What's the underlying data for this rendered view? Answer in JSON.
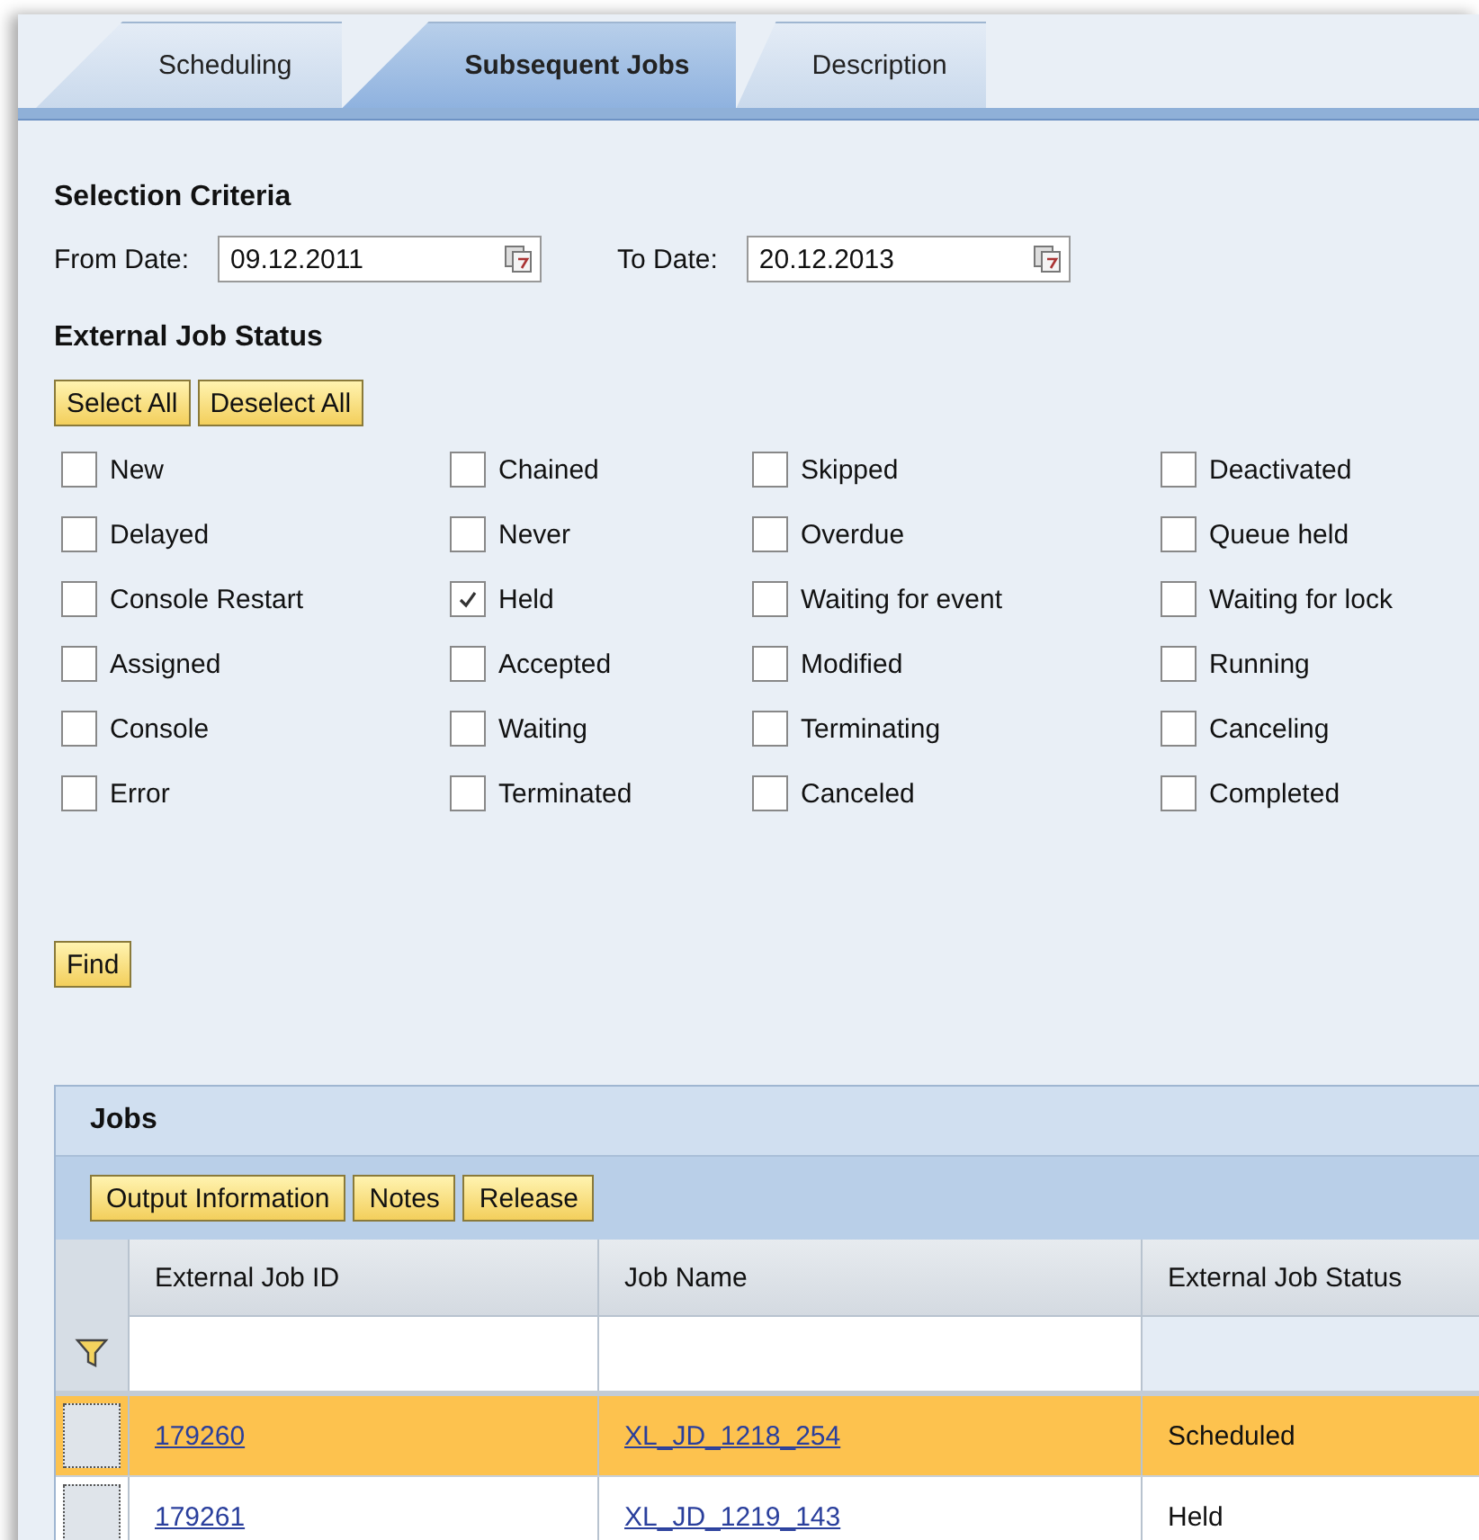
{
  "tabs": [
    {
      "label": "Scheduling",
      "selected": false
    },
    {
      "label": "Subsequent Jobs",
      "selected": true
    },
    {
      "label": "Description",
      "selected": false
    }
  ],
  "selection_criteria": {
    "title": "Selection Criteria",
    "date_fields": [
      {
        "label": "From Date:",
        "value": "09.12.2011"
      },
      {
        "label": "To Date:",
        "value": "20.12.2013"
      }
    ]
  },
  "external_job_status": {
    "title": "External Job Status",
    "buttons": [
      "Select All",
      "Deselect All"
    ],
    "options": [
      {
        "label": "New",
        "checked": false
      },
      {
        "label": "Chained",
        "checked": false
      },
      {
        "label": "Skipped",
        "checked": false
      },
      {
        "label": "Deactivated",
        "checked": false
      },
      {
        "label": "Delayed",
        "checked": false
      },
      {
        "label": "Never",
        "checked": false
      },
      {
        "label": "Overdue",
        "checked": false
      },
      {
        "label": "Queue held",
        "checked": false
      },
      {
        "label": "Console Restart",
        "checked": false
      },
      {
        "label": "Held",
        "checked": true
      },
      {
        "label": "Waiting for event",
        "checked": false
      },
      {
        "label": "Waiting for lock",
        "checked": false
      },
      {
        "label": "Assigned",
        "checked": false
      },
      {
        "label": "Accepted",
        "checked": false
      },
      {
        "label": "Modified",
        "checked": false
      },
      {
        "label": "Running",
        "checked": false
      },
      {
        "label": "Console",
        "checked": false
      },
      {
        "label": "Waiting",
        "checked": false
      },
      {
        "label": "Terminating",
        "checked": false
      },
      {
        "label": "Canceling",
        "checked": false
      },
      {
        "label": "Error",
        "checked": false
      },
      {
        "label": "Terminated",
        "checked": false
      },
      {
        "label": "Canceled",
        "checked": false
      },
      {
        "label": "Completed",
        "checked": false
      }
    ]
  },
  "find_button": "Find",
  "jobs": {
    "title": "Jobs",
    "toolbar": [
      "Output Information",
      "Notes",
      "Release"
    ],
    "columns": [
      "External Job ID",
      "Job Name",
      "External Job Status"
    ],
    "rows": [
      {
        "id": "179260",
        "name": "XL_JD_1218_254",
        "status": "Scheduled",
        "selected": true
      },
      {
        "id": "179261",
        "name": "XL_JD_1219_143",
        "status": "Held",
        "selected": false
      }
    ]
  }
}
